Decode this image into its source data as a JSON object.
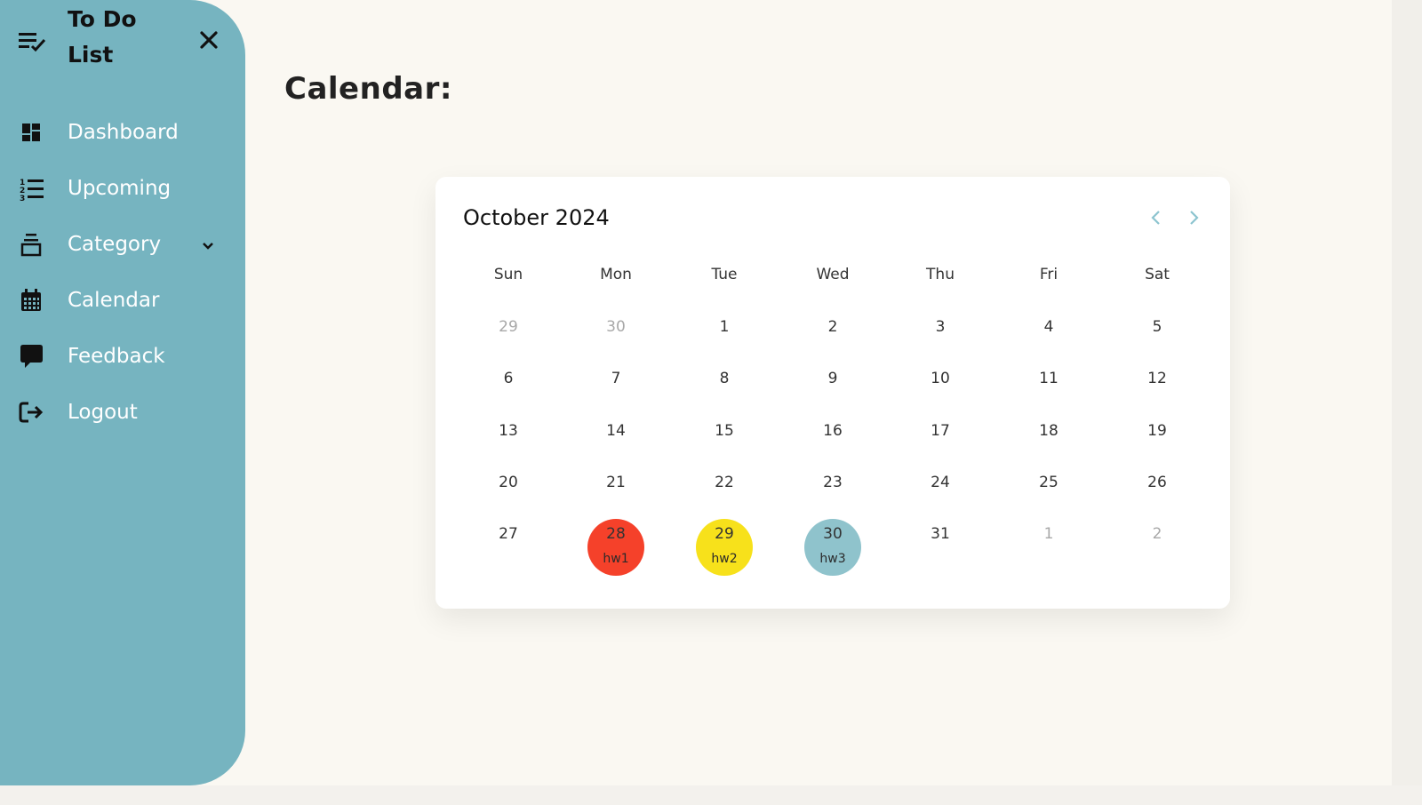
{
  "sidebar": {
    "title": "To Do List",
    "items": [
      {
        "label": "Dashboard",
        "icon": "dashboard-icon"
      },
      {
        "label": "Upcoming",
        "icon": "numbered-list-icon"
      },
      {
        "label": "Category",
        "icon": "stack-icon",
        "has_dropdown": true
      },
      {
        "label": "Calendar",
        "icon": "calendar-icon"
      },
      {
        "label": "Feedback",
        "icon": "chat-bubble-icon"
      },
      {
        "label": "Logout",
        "icon": "logout-icon"
      }
    ]
  },
  "main": {
    "title": "Calendar:"
  },
  "calendar": {
    "month_label": "October 2024",
    "weekdays": [
      "Sun",
      "Mon",
      "Tue",
      "Wed",
      "Thu",
      "Fri",
      "Sat"
    ],
    "weeks": [
      [
        {
          "day": "29",
          "muted": true
        },
        {
          "day": "30",
          "muted": true
        },
        {
          "day": "1"
        },
        {
          "day": "2"
        },
        {
          "day": "3"
        },
        {
          "day": "4"
        },
        {
          "day": "5"
        }
      ],
      [
        {
          "day": "6"
        },
        {
          "day": "7"
        },
        {
          "day": "8"
        },
        {
          "day": "9"
        },
        {
          "day": "10"
        },
        {
          "day": "11"
        },
        {
          "day": "12"
        }
      ],
      [
        {
          "day": "13"
        },
        {
          "day": "14"
        },
        {
          "day": "15"
        },
        {
          "day": "16"
        },
        {
          "day": "17"
        },
        {
          "day": "18"
        },
        {
          "day": "19"
        }
      ],
      [
        {
          "day": "20"
        },
        {
          "day": "21"
        },
        {
          "day": "22"
        },
        {
          "day": "23"
        },
        {
          "day": "24"
        },
        {
          "day": "25"
        },
        {
          "day": "26"
        }
      ],
      [
        {
          "day": "27"
        },
        {
          "day": "28",
          "event": "hw1",
          "color": "#f5412a"
        },
        {
          "day": "29",
          "event": "hw2",
          "color": "#f7e11b"
        },
        {
          "day": "30",
          "event": "hw3",
          "color": "#8fc3cc"
        },
        {
          "day": "31"
        },
        {
          "day": "1",
          "muted": true
        },
        {
          "day": "2",
          "muted": true
        }
      ]
    ]
  },
  "colors": {
    "sidebar_bg": "#76b4c0",
    "page_bg": "#faf8f2",
    "arrow": "#8cc4cf"
  }
}
